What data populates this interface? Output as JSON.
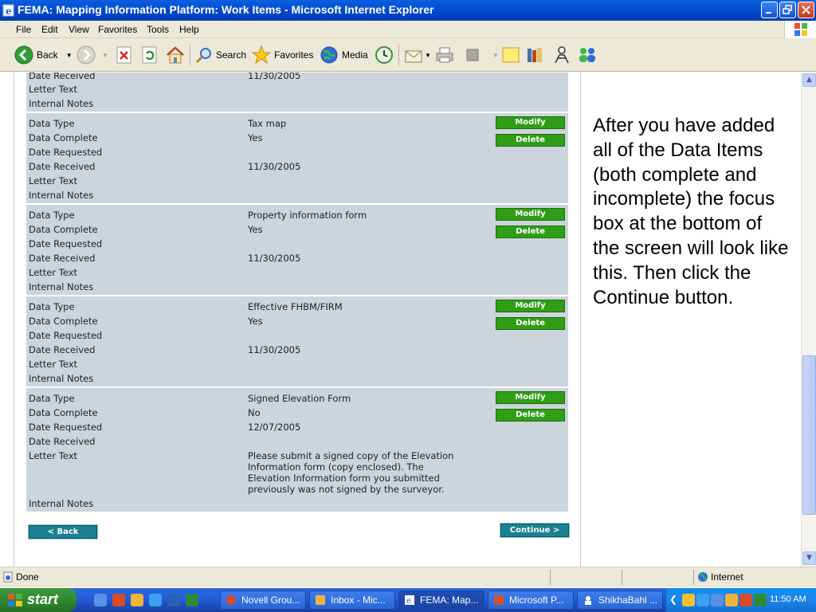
{
  "window": {
    "title": "FEMA: Mapping Information Platform: Work Items - Microsoft Internet Explorer"
  },
  "menu": [
    "File",
    "Edit",
    "View",
    "Favorites",
    "Tools",
    "Help"
  ],
  "toolbar": {
    "back_label": "Back",
    "search_label": "Search",
    "favorites_label": "Favorites",
    "media_label": "Media"
  },
  "records": [
    {
      "rows": [
        {
          "label": "Date Received",
          "value": "11/30/2005"
        },
        {
          "label": "Letter Text",
          "value": ""
        },
        {
          "label": "Internal Notes",
          "value": ""
        }
      ]
    },
    {
      "modify_label": "Modify",
      "delete_label": "Delete",
      "rows": [
        {
          "label": "Data Type",
          "value": "Tax map"
        },
        {
          "label": "Data Complete",
          "value": "Yes"
        },
        {
          "label": "Date Requested",
          "value": ""
        },
        {
          "label": "Date Received",
          "value": "11/30/2005"
        },
        {
          "label": "Letter Text",
          "value": ""
        },
        {
          "label": "Internal Notes",
          "value": ""
        }
      ]
    },
    {
      "modify_label": "Modify",
      "delete_label": "Delete",
      "rows": [
        {
          "label": "Data Type",
          "value": "Property information form"
        },
        {
          "label": "Data Complete",
          "value": "Yes"
        },
        {
          "label": "Date Requested",
          "value": ""
        },
        {
          "label": "Date Received",
          "value": "11/30/2005"
        },
        {
          "label": "Letter Text",
          "value": ""
        },
        {
          "label": "Internal Notes",
          "value": ""
        }
      ]
    },
    {
      "modify_label": "Modify",
      "delete_label": "Delete",
      "rows": [
        {
          "label": "Data Type",
          "value": "Effective FHBM/FIRM"
        },
        {
          "label": "Data Complete",
          "value": "Yes"
        },
        {
          "label": "Date Requested",
          "value": ""
        },
        {
          "label": "Date Received",
          "value": "11/30/2005"
        },
        {
          "label": "Letter Text",
          "value": ""
        },
        {
          "label": "Internal Notes",
          "value": ""
        }
      ]
    },
    {
      "modify_label": "Modify",
      "delete_label": "Delete",
      "rows": [
        {
          "label": "Data Type",
          "value": "Signed Elevation Form"
        },
        {
          "label": "Data Complete",
          "value": "No"
        },
        {
          "label": "Date Requested",
          "value": "12/07/2005"
        },
        {
          "label": "Date Received",
          "value": ""
        },
        {
          "label": "Letter Text",
          "value": "Please submit a signed copy of the Elevation Information form (copy enclosed). The Elevation Information form you submitted previously was not signed by the surveyor."
        },
        {
          "label": "Internal Notes",
          "value": ""
        }
      ]
    }
  ],
  "nav": {
    "back_label": "< Back",
    "continue_label": "Continue >"
  },
  "note": "After you have added all of the Data Items (both complete and incomplete) the focus box at the bottom of the screen will look like this. Then click the Continue button.",
  "status": {
    "text": "Done",
    "zone": "Internet"
  },
  "taskbar": {
    "start_label": "start",
    "tasks": [
      "Novell Grou...",
      "Inbox - Mic...",
      "FEMA: Map...",
      "Microsoft P...",
      "ShikhaBahl ..."
    ],
    "clock": "11:50 AM"
  },
  "colors": {
    "panel": "#ccd4dd",
    "action_button": "#2f9e16",
    "nav_button": "#1b8192"
  }
}
